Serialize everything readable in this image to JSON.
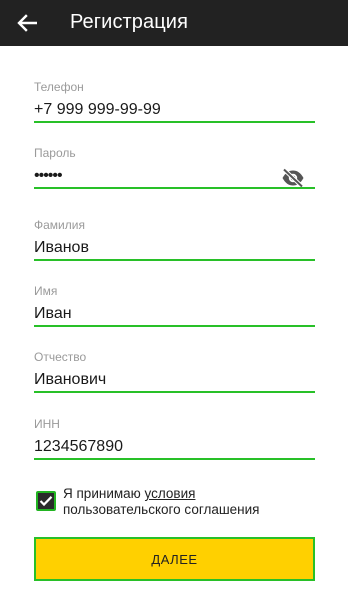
{
  "appbar": {
    "title": "Регистрация",
    "back_icon": "arrow-back-icon"
  },
  "form": {
    "phone": {
      "label": "Телефон",
      "value": "+7 999 999-99-99"
    },
    "password": {
      "label": "Пароль",
      "value": "••••••",
      "toggle_icon": "eye-off-icon"
    },
    "last_name": {
      "label": "Фамилия",
      "value": "Иванов"
    },
    "first_name": {
      "label": "Имя",
      "value": "Иван"
    },
    "middle_name": {
      "label": "Отчество",
      "value": "Иванович"
    },
    "inn": {
      "label": "ИНН",
      "value": "1234567890"
    }
  },
  "agreement": {
    "checked": true,
    "text_before": "Я принимаю ",
    "link_text": "условия",
    "text_after": "пользовательского соглашения"
  },
  "next_button": {
    "label": "ДАЛЕЕ"
  },
  "colors": {
    "appbar": "#222222",
    "accent_green": "#28c028",
    "button_yellow": "#ffd000"
  }
}
